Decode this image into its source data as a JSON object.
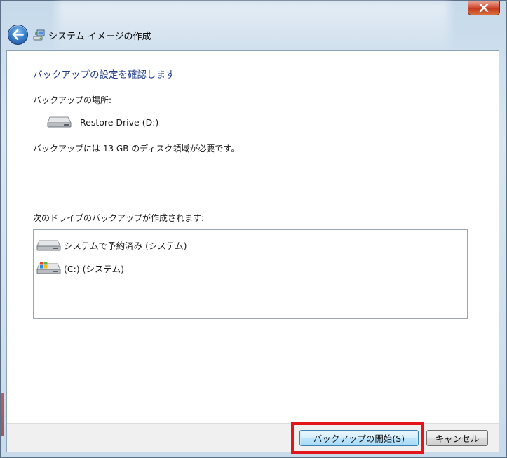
{
  "window": {
    "title": "システム イメージの作成",
    "close_glyph": "✕"
  },
  "content": {
    "heading": "バックアップの設定を確認します",
    "location_label": "バックアップの場所:",
    "location_drive": "Restore Drive (D:)",
    "space_notice": "バックアップには 13 GB のディスク領域が必要です。",
    "drives_label": "次のドライブのバックアップが作成されます:",
    "drives": [
      {
        "label": "システムで予約済み (システム)",
        "icon": "hard-drive-icon"
      },
      {
        "label": "(C:) (システム)",
        "icon": "windows-drive-icon"
      }
    ]
  },
  "buttons": {
    "start_backup": "バックアップの開始(S)",
    "cancel": "キャンセル"
  },
  "colors": {
    "heading": "#1e3a8a",
    "highlight": "#e3141a",
    "primary_border": "#3c7fb1"
  }
}
